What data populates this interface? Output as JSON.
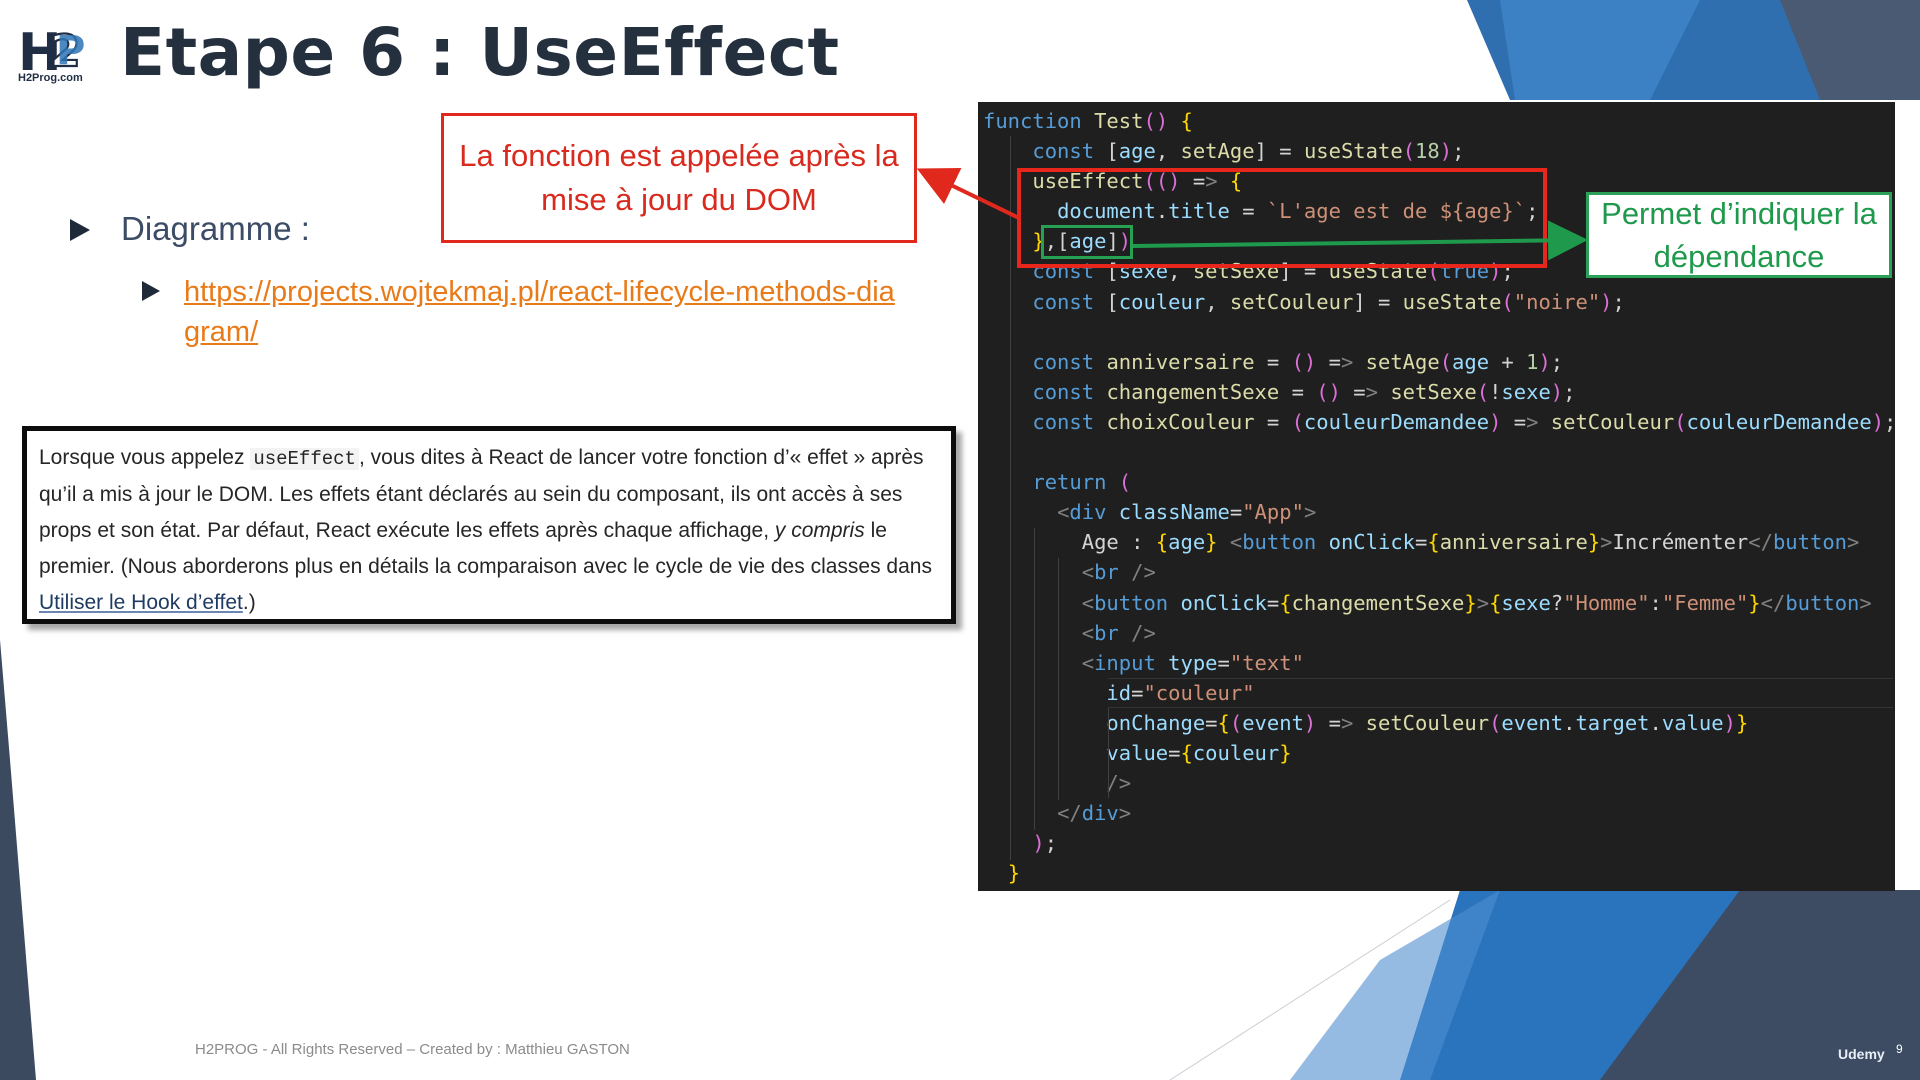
{
  "slide": {
    "title": "Etape 6 : UseEffect",
    "logo_text": "H2Prog.com",
    "bullet1": "Diagramme :",
    "link": "https://projects.wojtekmaj.pl/react-lifecycle-methods-diagram/",
    "quote": {
      "part1": "Lorsque vous appelez ",
      "code": "useEffect",
      "part2": ", vous dites à React de lancer votre fonction d’« effet » après qu’il a mis à jour le DOM. Les effets étant déclarés au sein du composant, ils ont accès à ses props et son état. Par défaut, React exécute les effets après chaque affichage, ",
      "italic": "y compris",
      "part3": " le premier. (Nous aborderons plus en détails la comparaison avec le cycle de vie des classes dans ",
      "link_text": "Utiliser le Hook d’effet",
      "part4": ".)"
    },
    "callout_red": "La fonction est appelée après la mise à jour du DOM",
    "callout_green": "Permet d’indiquer la dépendance",
    "footer": "H2PROG - All Rights Reserved – Created by : Matthieu GASTON",
    "udemy": "Udemy",
    "page_number": "9"
  },
  "code_lines": [
    "function Test() {",
    "    const [age, setAge] = useState(18);",
    "    useEffect(() => {",
    "      document.title = `L'age est de ${age}`;",
    "    },[age])",
    "    const [sexe, setSexe] = useState(true);",
    "    const [couleur, setCouleur] = useState(\"noire\");",
    "",
    "    const anniversaire = () => setAge(age + 1);",
    "    const changementSexe = () => setSexe(!sexe);",
    "    const choixCouleur = (couleurDemandee) => setCouleur(couleurDemandee);",
    "",
    "    return (",
    "      <div className=\"App\">",
    "        Age : {age} <button onClick={anniversaire}>Incrémenter</button>",
    "        <br />",
    "        <button onClick={changementSexe}>{sexe?\"Homme\":\"Femme\"}</button>",
    "        <br />",
    "        <input type=\"text\"",
    "          id=\"couleur\" ",
    "          onChange={(event) => setCouleur(event.target.value)}",
    "          value={couleur}",
    "          />",
    "      </div>",
    "    );",
    "  }"
  ],
  "colors": {
    "title": "#25303f",
    "link": "#e97a18",
    "callout_red": "#e0281d",
    "callout_green": "#2aa157",
    "code_bg": "#1f1f1f",
    "deco_blue": "#2f75b5"
  }
}
